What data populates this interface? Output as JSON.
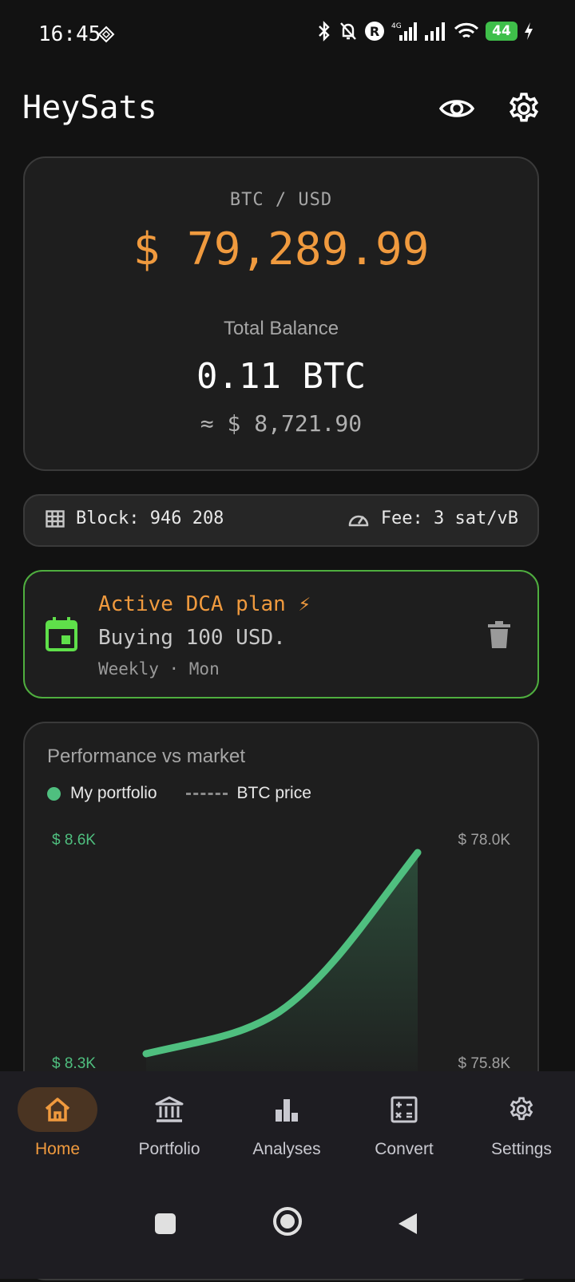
{
  "status_bar": {
    "time": "16:45",
    "battery": "44"
  },
  "header": {
    "title": "HeySats"
  },
  "price_card": {
    "pair": "BTC / USD",
    "price": "$ 79,289.99",
    "balance_label": "Total Balance",
    "balance_btc": "0.11 BTC",
    "balance_usd": "≈ $ 8,721.90"
  },
  "network": {
    "block": "Block: 946 208",
    "fee": "Fee: 3 sat/vB"
  },
  "dca": {
    "title": "Active DCA plan ⚡",
    "subtitle": "Buying 100 USD.",
    "frequency": "Weekly · Mon"
  },
  "performance": {
    "title": "Performance vs market",
    "legend_portfolio": "My portfolio",
    "legend_btc": "BTC price",
    "left_top": "$ 8.6K",
    "left_bottom": "$ 8.3K",
    "right_top": "$ 78.0K",
    "right_bottom": "$ 75.8K"
  },
  "nav": {
    "items": [
      {
        "label": "Home",
        "icon": "home-icon",
        "active": true
      },
      {
        "label": "Portfolio",
        "icon": "bank-icon",
        "active": false
      },
      {
        "label": "Analyses",
        "icon": "bar-chart-icon",
        "active": false
      },
      {
        "label": "Convert",
        "icon": "calculator-icon",
        "active": false
      },
      {
        "label": "Settings",
        "icon": "gear-icon",
        "active": false
      }
    ]
  },
  "colors": {
    "accent": "#f09a3e",
    "portfolio_line": "#4fbf7f",
    "dca_border": "#4fae3f"
  }
}
